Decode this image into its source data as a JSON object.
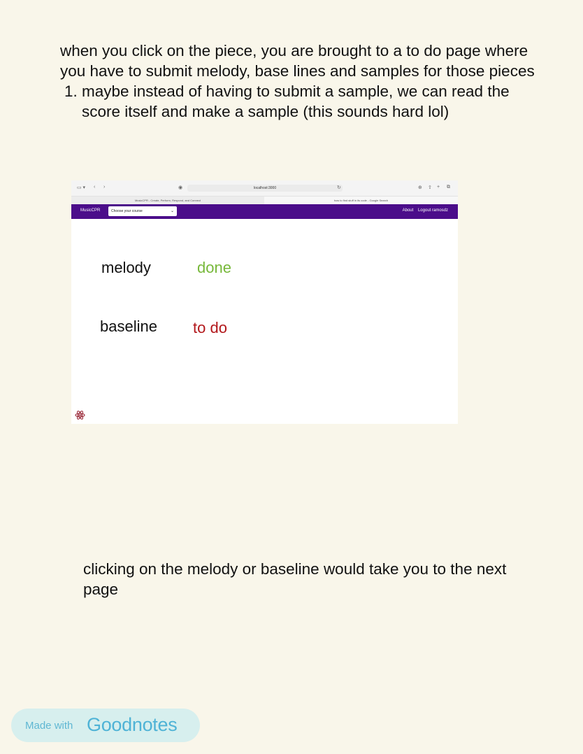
{
  "note": {
    "paragraph": "when you click on the piece, you are brought to a to do page where you have to submit melody, base lines and samples for those pieces",
    "list": [
      "maybe instead of having to submit a sample, we can read the score itself and make a sample (this sounds hard lol)"
    ]
  },
  "screenshot": {
    "address": "localhost:3000",
    "tabs": [
      "MusicCPR - Create, Perform, Respond, and Connect",
      "how to find stuff in its code - Google Search"
    ],
    "navbar": {
      "brand": "MusicCPR",
      "course_select": "Choose your course",
      "about": "About",
      "logout": "Logout ramosdz"
    },
    "tasks": [
      {
        "label": "melody",
        "status": "done",
        "status_color": "#77b83a"
      },
      {
        "label": "baseline",
        "status": "to do",
        "status_color": "#b2171b"
      }
    ],
    "nav_color": "#4b0d8a"
  },
  "footer_note": "clicking on the melody or baseline would take you to the next page",
  "badge": {
    "prefix": "Made with",
    "brand": "Goodnotes"
  },
  "icons": [
    "sidebar-icon",
    "back-icon",
    "forward-icon",
    "shield-icon",
    "reload-icon",
    "download-icon",
    "share-icon",
    "new-tab-icon",
    "tabs-icon",
    "chevron-down-icon",
    "react-logo-icon"
  ]
}
